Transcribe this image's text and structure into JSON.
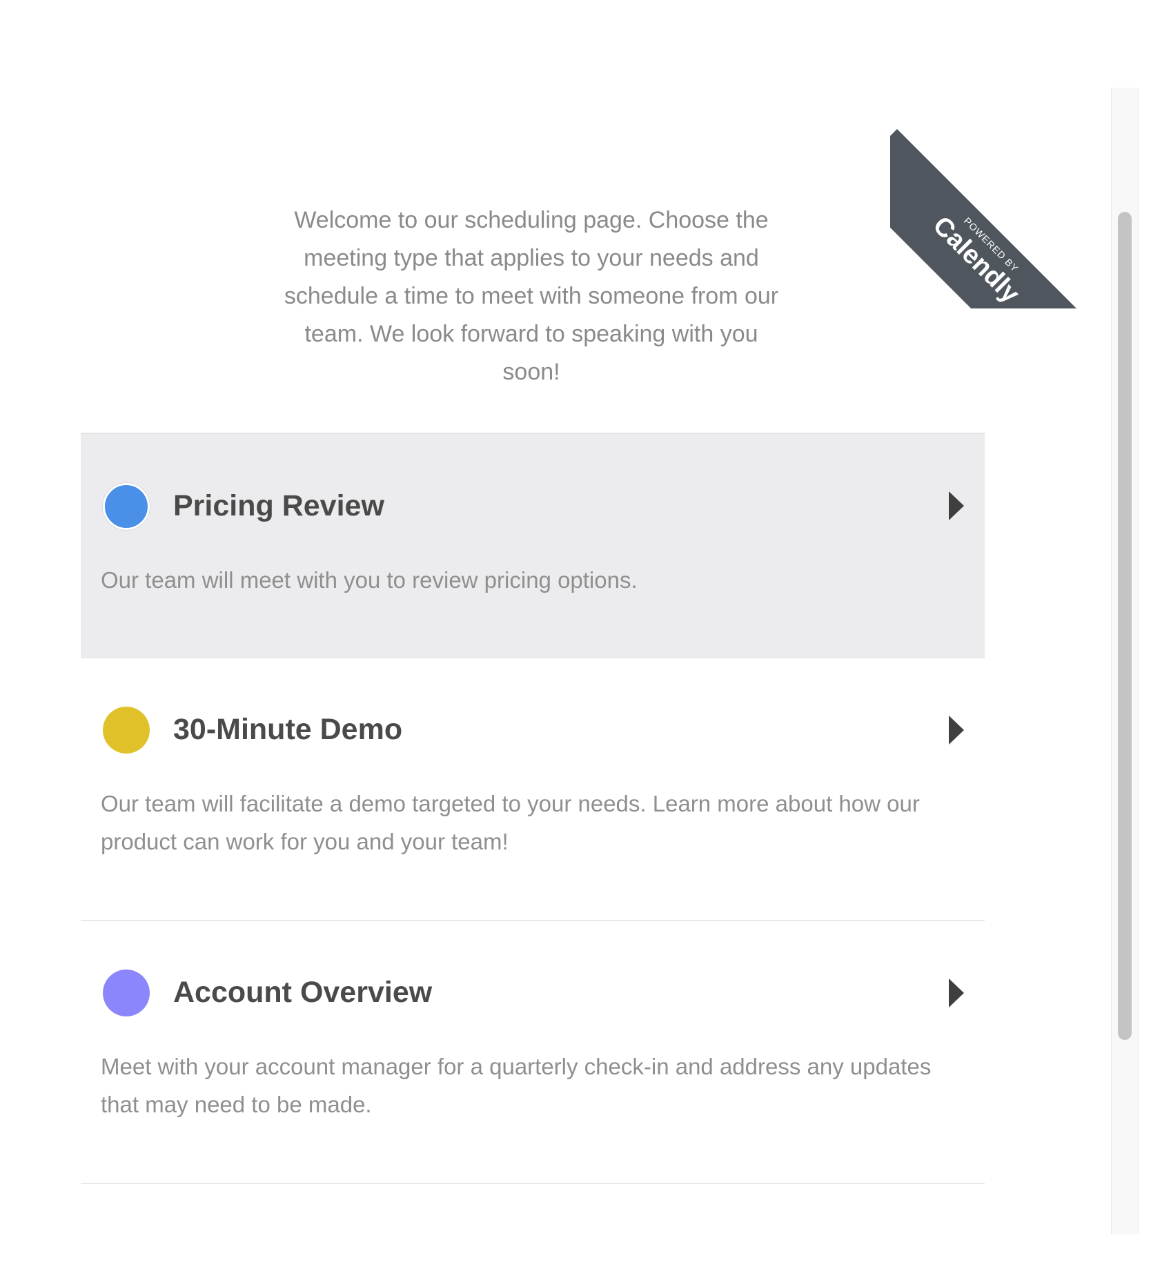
{
  "branding": {
    "powered_by": "POWERED BY",
    "brand": "Calendly",
    "ribbon_color": "#4f565d"
  },
  "intro": {
    "text": "Welcome to our scheduling page. Choose the meeting type that applies to your needs and schedule a time to meet with someone from our team. We look forward to speaking with you soon!"
  },
  "events": [
    {
      "title": "Pricing Review",
      "description": "Our team will meet with you to review pricing options.",
      "color": "#4a90e8",
      "highlighted": true,
      "arrow_icon": "caret-right-icon"
    },
    {
      "title": "30-Minute Demo",
      "description": "Our team will facilitate a demo targeted to your needs. Learn more about how our product can work for you and your team!",
      "color": "#e0c12a",
      "highlighted": false,
      "arrow_icon": "caret-right-icon"
    },
    {
      "title": "Account Overview",
      "description": "Meet with your account manager for a quarterly check-in and address any updates that may need to be made.",
      "color": "#8b86fb",
      "highlighted": false,
      "arrow_icon": "caret-right-icon"
    }
  ]
}
